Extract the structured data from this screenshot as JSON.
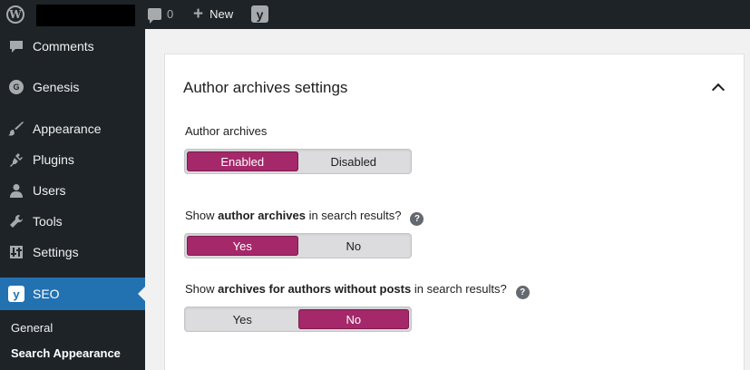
{
  "adminbar": {
    "comments_count": "0",
    "new_label": "New",
    "logo_glyph": "W",
    "yoast_glyph": "y"
  },
  "sidebar": {
    "items": [
      {
        "label": "Comments",
        "icon": "comment-icon"
      },
      {
        "label": "Genesis",
        "icon": "genesis-icon",
        "glyph": "G"
      },
      {
        "label": "Appearance",
        "icon": "brush-icon"
      },
      {
        "label": "Plugins",
        "icon": "plugin-icon"
      },
      {
        "label": "Users",
        "icon": "user-icon"
      },
      {
        "label": "Tools",
        "icon": "wrench-icon"
      },
      {
        "label": "Settings",
        "icon": "settings-icon"
      },
      {
        "label": "SEO",
        "icon": "yoast-icon",
        "glyph": "y"
      }
    ],
    "submenu": [
      {
        "label": "General"
      },
      {
        "label": "Search Appearance"
      }
    ]
  },
  "panel": {
    "title": "Author archives settings",
    "author_archives": {
      "label": "Author archives",
      "options": [
        "Enabled",
        "Disabled"
      ],
      "selected": "Enabled"
    },
    "show_in_search": {
      "label_pre": "Show ",
      "label_bold": "author archives",
      "label_post": " in search results?",
      "help_glyph": "?",
      "options": [
        "Yes",
        "No"
      ],
      "selected": "Yes"
    },
    "no_posts": {
      "label_pre": "Show ",
      "label_bold": "archives for authors without posts",
      "label_post": " in search results?",
      "help_glyph": "?",
      "options": [
        "Yes",
        "No"
      ],
      "selected": "No"
    }
  },
  "colors": {
    "accent": "#a4286a",
    "menu_current": "#2271b1",
    "adminbar": "#1d2327"
  }
}
